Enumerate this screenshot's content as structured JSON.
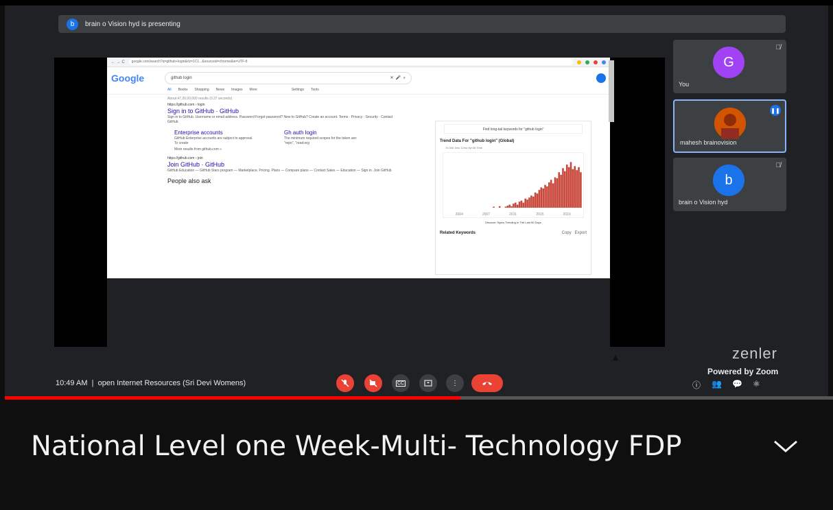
{
  "meeting": {
    "presenting_text": "brain o Vision hyd is presenting",
    "presenter_initial": "b",
    "time": "10:49 AM",
    "separator": "|",
    "meeting_name": "open Internet Resources (Sri Devi Womens)"
  },
  "participants": [
    {
      "name": "You",
      "initial": "G",
      "color": "#a142f4",
      "muted_icon": "mic-off-icon"
    },
    {
      "name": "mahesh brainovision",
      "initial": "",
      "color": "#c0392b",
      "muted_icon": "speaking-icon"
    },
    {
      "name": "brain o Vision hyd",
      "initial": "b",
      "color": "#1a73e8",
      "muted_icon": "mic-off-icon"
    }
  ],
  "shared_screen": {
    "url": "google.com/search?q=github+login&rlz=1C1...&sourceid=chrome&ie=UTF-8",
    "logo": "Google",
    "query": "github login",
    "tabs": [
      "All",
      "Books",
      "Shopping",
      "News",
      "Images",
      "More",
      "Settings",
      "Tools"
    ],
    "stats": "About 47,20,00,000 results (0.37 seconds)",
    "results": [
      {
        "url": "https://github.com › login",
        "title": "Sign in to GitHub · GitHub",
        "snippet": "Sign in to GitHub. Username or email address. Password Forgot password? New to GitHub? Create an account. Terms · Privacy · Security · Contact GitHub"
      },
      {
        "url": "https://github.com › join",
        "title": "Join GitHub · GitHub",
        "snippet": "GitHub Education — GitHub Stars program — Marketplace. Pricing. Plans — Compare plans — Contact Sales — Education — Sign in. Join GitHub"
      }
    ],
    "sublinks": [
      {
        "title": "Enterprise accounts",
        "snippet": "GitHub Enterprise accounts are subject to approval. To create"
      },
      {
        "title": "Gh auth login",
        "snippet": "The minimum required scopes for the token are: \"repo\", \"read:org"
      }
    ],
    "more_results": "More results from github.com »",
    "people_also_ask": "People also ask",
    "panel": {
      "top_button": "Find long-tail keywords for \"github login\"",
      "trend_title": "Trend Data For \"github login\" (Global)",
      "trend_tabs": "7d  30d  3mo  12mo  5yr  All Time",
      "discover": "Discover Topics Trending In The Last 90 Days",
      "related": "Related Keywords",
      "copy": "Copy",
      "export": "Export"
    }
  },
  "chart_data": {
    "type": "bar",
    "title": "Trend Data For \"github login\" (Global)",
    "xlabel": "",
    "ylabel": "",
    "x_tick_labels": [
      "2004",
      "2007",
      "2011",
      "2015",
      "2019"
    ],
    "values": [
      0,
      0,
      0,
      0,
      0,
      0,
      0,
      0,
      0,
      0,
      0,
      0,
      0,
      0,
      0,
      0,
      0,
      0,
      0,
      0,
      0,
      0,
      0,
      2,
      0,
      0,
      3,
      0,
      0,
      2,
      4,
      6,
      3,
      8,
      10,
      6,
      12,
      14,
      10,
      18,
      16,
      20,
      24,
      22,
      30,
      28,
      35,
      40,
      38,
      45,
      42,
      50,
      55,
      48,
      60,
      58,
      70,
      65,
      78,
      72,
      85,
      80,
      90,
      76,
      82,
      74,
      80,
      70
    ],
    "ylim": [
      0,
      100
    ],
    "color": "#c9473a"
  },
  "controls": {
    "mic_icon": "mic-off-icon",
    "camera_icon": "camera-off-icon",
    "cc_label": "CC",
    "present_icon": "present-icon",
    "more_icon": "more-vertical-icon",
    "end_icon": "end-call-icon"
  },
  "branding": {
    "zenler": "zenler",
    "powered": "Powered by Zoom"
  },
  "video": {
    "progress_fraction": 0.55,
    "title": "National Level one Week-Multi- Technology FDP"
  },
  "colors": {
    "accent_red": "#ea4335",
    "progress_red": "#ff0000",
    "meet_bg": "#202124"
  }
}
